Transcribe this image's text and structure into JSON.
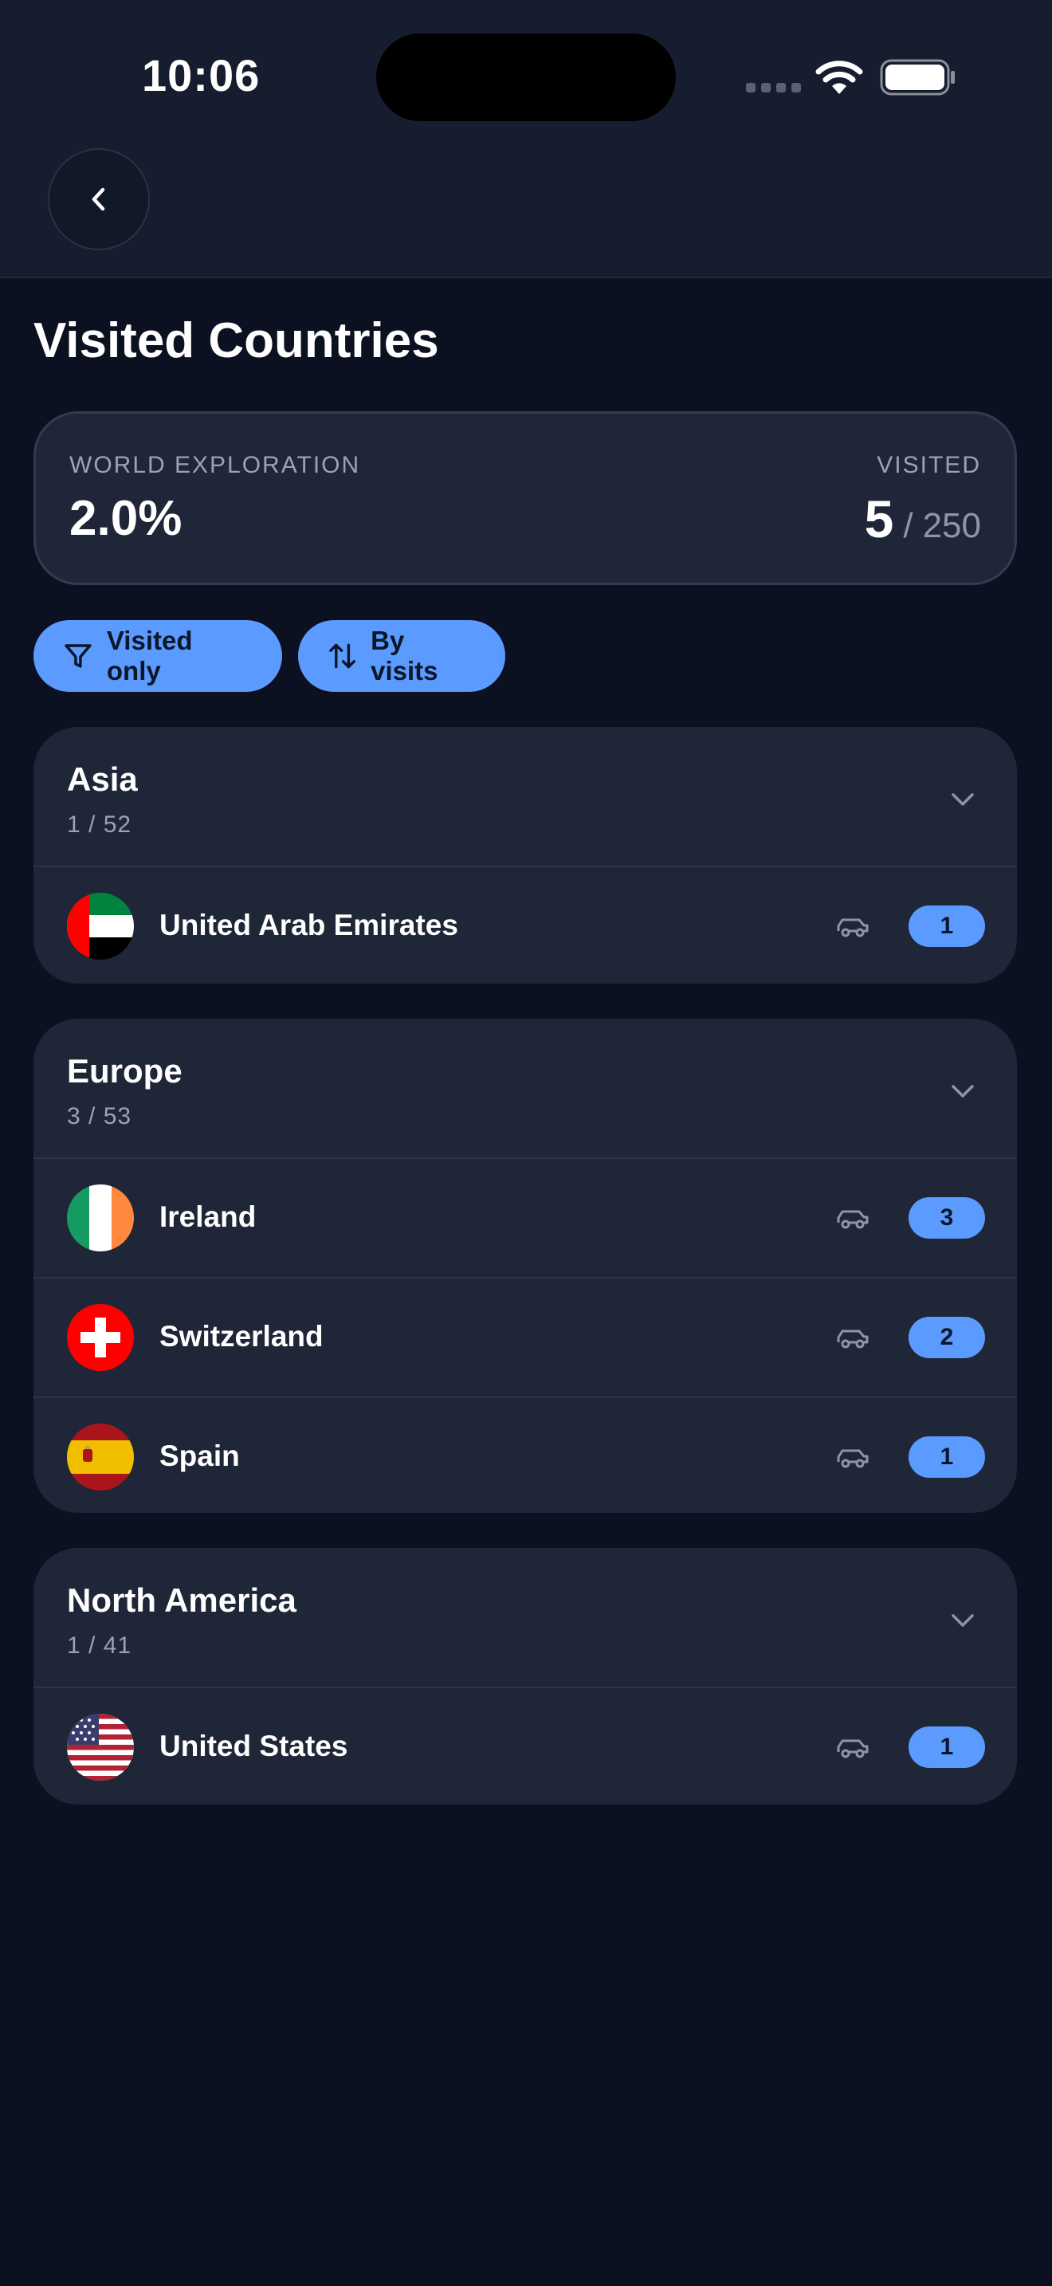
{
  "status": {
    "time": "10:06"
  },
  "page": {
    "title": "Visited Countries"
  },
  "stats": {
    "world_label": "WORLD EXPLORATION",
    "world_value": "2.0%",
    "visited_label": "VISITED",
    "visited_count": "5",
    "visited_separator": "/",
    "visited_total": "250"
  },
  "filters": {
    "visited_only": "Visited only",
    "sort": "By visits"
  },
  "groups": [
    {
      "name": "Asia",
      "count": "1 / 52",
      "countries": [
        {
          "name": "United Arab Emirates",
          "visits": "1",
          "flag": "ae"
        }
      ]
    },
    {
      "name": "Europe",
      "count": "3 / 53",
      "countries": [
        {
          "name": "Ireland",
          "visits": "3",
          "flag": "ie"
        },
        {
          "name": "Switzerland",
          "visits": "2",
          "flag": "ch"
        },
        {
          "name": "Spain",
          "visits": "1",
          "flag": "es"
        }
      ]
    },
    {
      "name": "North America",
      "count": "1 / 41",
      "countries": [
        {
          "name": "United States",
          "visits": "1",
          "flag": "us"
        }
      ]
    }
  ],
  "colors": {
    "accent": "#5b9bff",
    "background": "#0b1120",
    "card": "#1f2637"
  },
  "icons": [
    "back-chevron-icon",
    "filter-icon",
    "sort-arrows-icon",
    "chevron-down-icon",
    "car-icon",
    "wifi-icon",
    "battery-icon"
  ]
}
